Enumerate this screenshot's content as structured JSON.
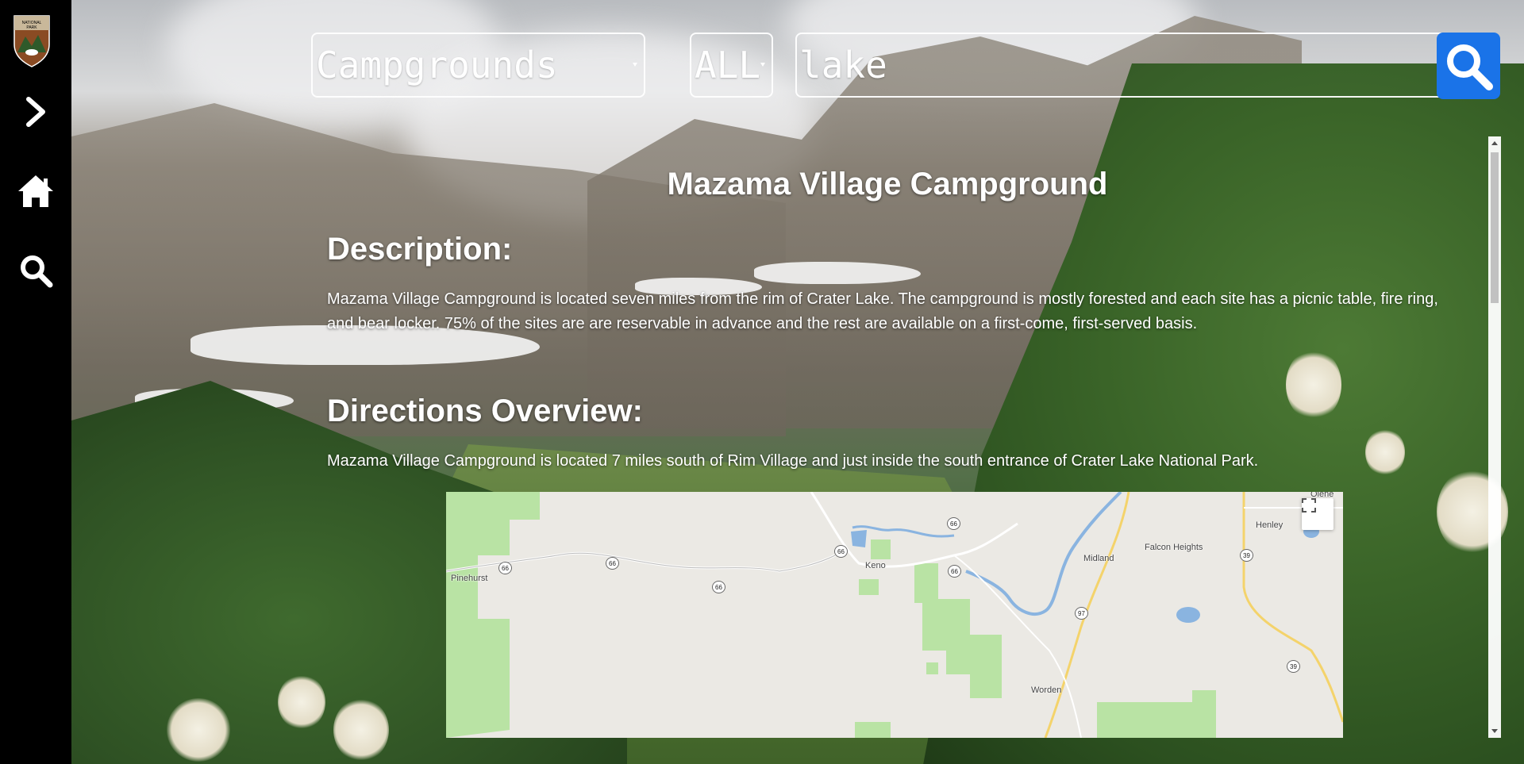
{
  "sidebar": {
    "logo_alt": "National Park Service",
    "items": [
      {
        "name": "expand",
        "icon": "chevron-right-icon"
      },
      {
        "name": "home",
        "icon": "home-icon"
      },
      {
        "name": "search",
        "icon": "search-icon"
      }
    ]
  },
  "search": {
    "category_value": "Campgrounds",
    "state_value": "ALL",
    "query_value": "lake",
    "button_icon": "search-icon",
    "button_color": "#1a73e8"
  },
  "campground": {
    "title": "Mazama Village Campground",
    "description_heading": "Description:",
    "description": "Mazama Village Campground is located seven miles from the rim of Crater Lake. The campground is mostly forested and each site has a picnic table, fire ring, and bear locker. 75% of the sites are are reservable in advance and the rest are available on a first-come, first-served basis.",
    "directions_heading": "Directions Overview:",
    "directions": "Mazama Village Campground is located 7 miles south of Rim Village and just inside the south entrance of Crater Lake National Park."
  },
  "map": {
    "places": [
      "Pinehurst",
      "Keno",
      "Midland",
      "Falcon Heights",
      "Henley",
      "Olene",
      "Worden"
    ],
    "routes": [
      "66",
      "66",
      "66",
      "66",
      "66",
      "66",
      "97",
      "39",
      "39"
    ],
    "fullscreen_icon": "fullscreen-icon"
  }
}
